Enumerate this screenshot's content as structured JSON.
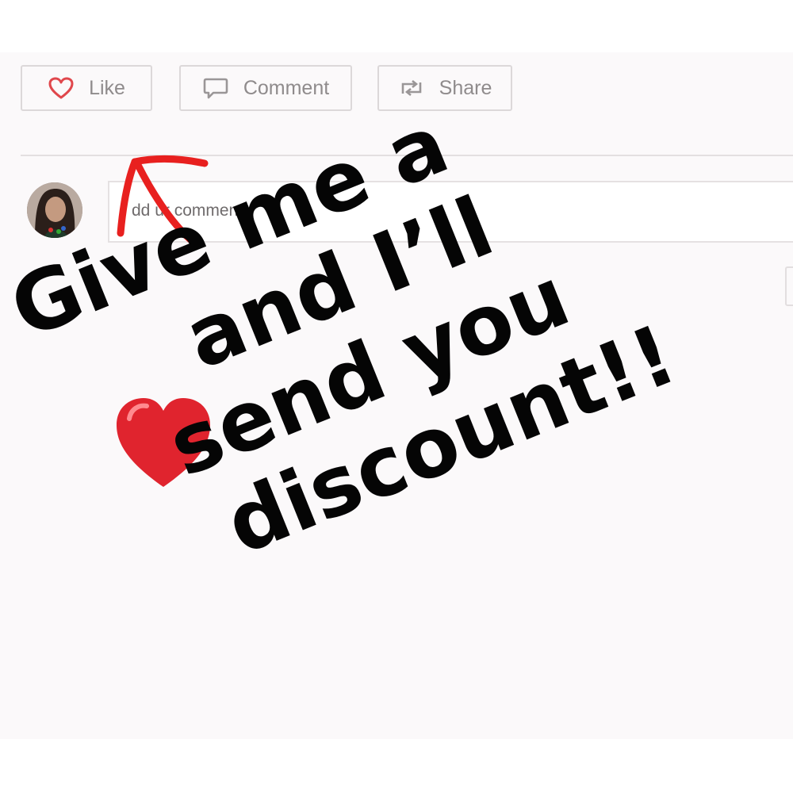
{
  "actions": {
    "like_label": "Like",
    "comment_label": "Comment",
    "share_label": "Share"
  },
  "comment_input": {
    "placeholder": "Add your comment..",
    "visible_text": "dd  ur comment.."
  },
  "caption": {
    "line1": "Give me a",
    "line2": "and I’ll",
    "line3": "send you",
    "line4": "discount!!"
  },
  "icons": {
    "like": "heart-outline-icon",
    "comment": "speech-bubble-icon",
    "share": "repost-arrows-icon",
    "emoji": "red-heart-emoji",
    "annotation": "red-arrow"
  },
  "colors": {
    "like_icon": "#e0474c",
    "arrow": "#e8201f",
    "heart_emoji": "#e0242e",
    "caption_text": "#050505"
  }
}
